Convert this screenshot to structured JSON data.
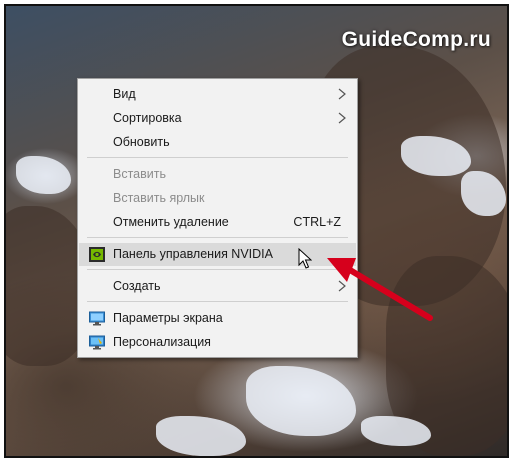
{
  "watermark": "GuideComp.ru",
  "menu": {
    "items": [
      {
        "label": "Вид",
        "submenu": true
      },
      {
        "label": "Сортировка",
        "submenu": true
      },
      {
        "label": "Обновить"
      },
      {
        "label": "Вставить",
        "disabled": true
      },
      {
        "label": "Вставить ярлык",
        "disabled": true
      },
      {
        "label": "Отменить удаление",
        "shortcut": "CTRL+Z"
      },
      {
        "label": "Панель управления NVIDIA",
        "icon": "nvidia-icon",
        "highlighted": true
      },
      {
        "label": "Создать",
        "submenu": true
      },
      {
        "label": "Параметры экрана",
        "icon": "display-settings-icon"
      },
      {
        "label": "Персонализация",
        "icon": "personalization-icon"
      }
    ]
  },
  "colors": {
    "menu_bg": "#f2f2f2",
    "highlight": "#dadada",
    "annotation_arrow": "#d6001c",
    "nvidia_green": "#76b900"
  }
}
